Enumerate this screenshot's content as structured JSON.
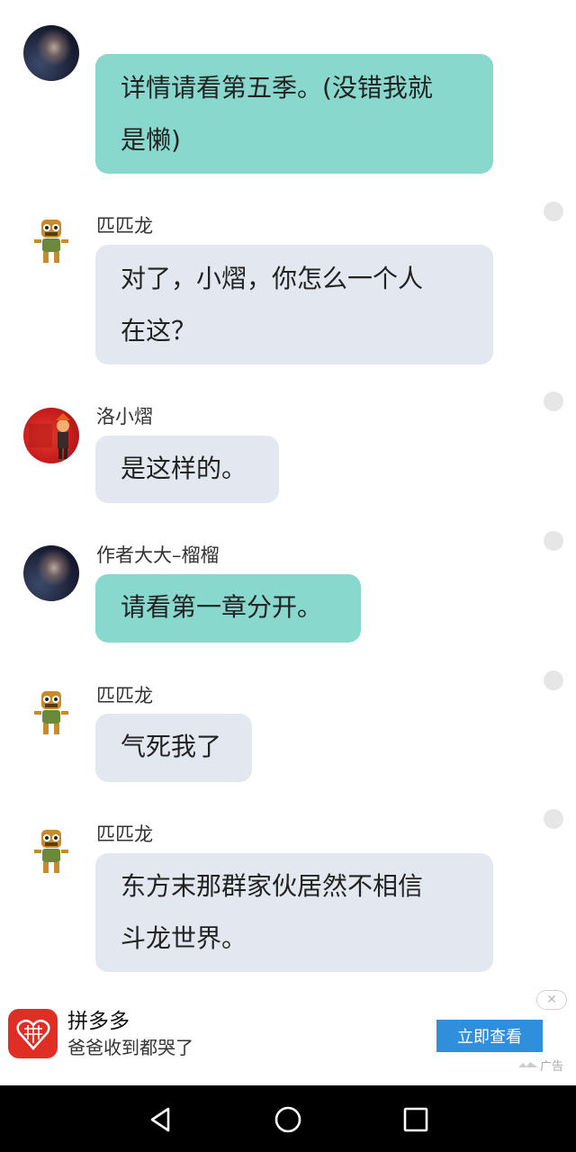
{
  "messages": [
    {
      "sender": "",
      "side": "author",
      "text_lines": [
        "详情请看第五季。(没错我就",
        "是懒)"
      ]
    },
    {
      "sender": "匹匹龙",
      "text_lines": [
        "对了，小熠，你怎么一个人",
        "在这？"
      ]
    },
    {
      "sender": "洛小熠",
      "text_lines": [
        "是这样的。"
      ]
    },
    {
      "sender": "作者大大–榴榴",
      "text_lines": [
        "请看第一章分开。"
      ]
    },
    {
      "sender": "匹匹龙",
      "text_lines": [
        "气死我了"
      ]
    },
    {
      "sender": "匹匹龙",
      "text_lines": [
        "东方末那群家伙居然不相信",
        "斗龙世界。"
      ]
    }
  ],
  "ad": {
    "app_name": "拼多多",
    "tagline": "爸爸收到都哭了",
    "cta": "立即查看",
    "label": "广告",
    "close_symbol": "✕"
  },
  "colors": {
    "author_bubble": "#88d8ce",
    "other_bubble": "#e3e7ef",
    "ad_button": "#2f8fdc",
    "ad_logo": "#e02e24"
  },
  "icons": [
    "galaxy-avatar",
    "robot-avatar",
    "red-avatar",
    "back-icon",
    "home-icon",
    "recents-icon",
    "close-icon"
  ]
}
